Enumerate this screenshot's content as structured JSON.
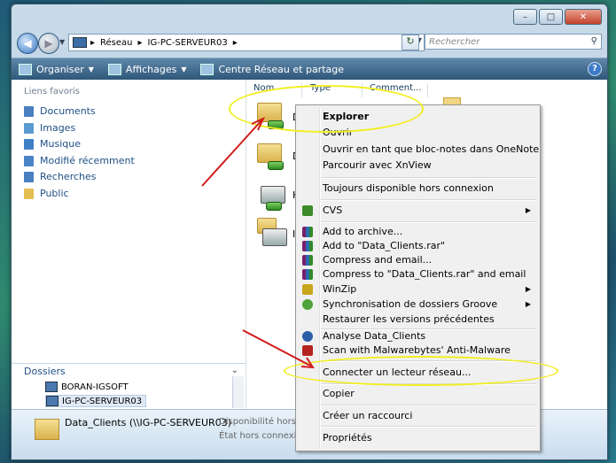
{
  "window": {
    "controls": {
      "minimize": "–",
      "maximize": "□",
      "close": "✕"
    }
  },
  "address_bar": {
    "segments": [
      "Réseau",
      "IG-PC-SERVEUR03"
    ],
    "separator": "▸",
    "search_placeholder": "Rechercher"
  },
  "toolbar": {
    "items": [
      {
        "label": "Organiser",
        "icon": "organize-icon",
        "has_dropdown": true
      },
      {
        "label": "Affichages",
        "icon": "views-icon",
        "has_dropdown": true
      },
      {
        "label": "Centre Réseau et partage",
        "icon": "network-center-icon",
        "has_dropdown": false
      }
    ],
    "help": "?"
  },
  "left_pane": {
    "favorites_header": "Liens favoris",
    "favorites": [
      {
        "label": "Documents",
        "icon": "documents-icon",
        "color": "#4a7fc1"
      },
      {
        "label": "Images",
        "icon": "images-icon",
        "color": "#5b9ad1"
      },
      {
        "label": "Musique",
        "icon": "music-icon",
        "color": "#3f7fc6"
      },
      {
        "label": "Modifié récemment",
        "icon": "recent-icon",
        "color": "#4b83c8"
      },
      {
        "label": "Recherches",
        "icon": "search-folder-icon",
        "color": "#4a7fc1"
      },
      {
        "label": "Public",
        "icon": "public-folder-icon",
        "color": "#e3bf52"
      }
    ],
    "folders_header": "Dossiers",
    "tree": [
      {
        "label": "BORAN-IGSOFT",
        "selected": false
      },
      {
        "label": "IG-PC-SERVEUR03",
        "selected": true
      }
    ]
  },
  "file_list": {
    "columns": [
      "Nom",
      "Type",
      "Comment..."
    ],
    "items": [
      {
        "label": "D",
        "icon": "network-folder-icon"
      },
      {
        "label": "D",
        "icon": "network-folder-icon"
      },
      {
        "label": "H",
        "icon": "printer-icon"
      },
      {
        "label": "I",
        "icon": "printer-icon"
      }
    ]
  },
  "details": {
    "name": "Data_Clients (\\\\IG-PC-SERVEUR03)",
    "availability": "Disponibilité hors ...",
    "offline_status": "État hors connexio..."
  },
  "context_menu": {
    "items": [
      {
        "label": "Explorer",
        "bold": true
      },
      {
        "label": "Ouvrir"
      },
      {
        "label": "Ouvrir en tant que bloc-notes dans OneNote"
      },
      {
        "label": "Parcourir avec XnView"
      },
      {
        "label": "Toujours disponible hors connexion"
      },
      {
        "label": "CVS",
        "submenu": true
      },
      {
        "label": "Add to archive..."
      },
      {
        "label": "Add to \"Data_Clients.rar\""
      },
      {
        "label": "Compress and email..."
      },
      {
        "label": "Compress to \"Data_Clients.rar\" and email"
      },
      {
        "label": "WinZip",
        "submenu": true
      },
      {
        "label": "Synchronisation de dossiers Groove",
        "submenu": true
      },
      {
        "label": "Restaurer les versions précédentes"
      },
      {
        "label": "Analyse Data_Clients"
      },
      {
        "label": "Scan with Malwarebytes' Anti-Malware"
      },
      {
        "label": "Connecter un lecteur réseau..."
      },
      {
        "label": "Copier"
      },
      {
        "label": "Créer un raccourci"
      },
      {
        "label": "Propriétés"
      }
    ],
    "submenu_arrow": "▶"
  },
  "annotation_color": "#f2ee22",
  "arrow_color": "#d11a1a"
}
